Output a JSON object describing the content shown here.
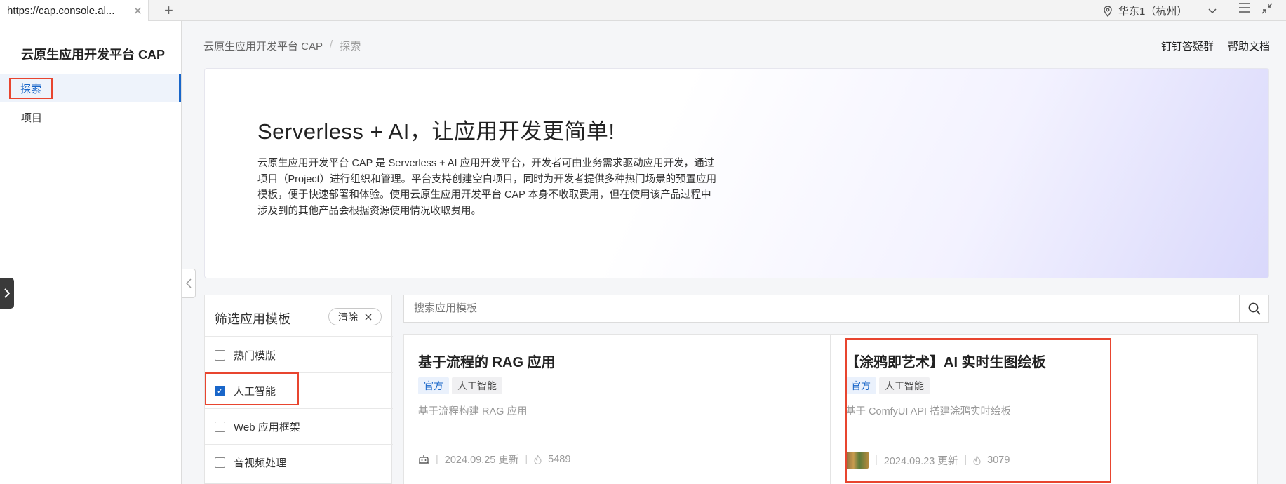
{
  "browser": {
    "tab_title": "https://cap.console.al...",
    "tab_close": "✕",
    "new_tab": "+",
    "region_label": "华东1（杭州）"
  },
  "sidebar": {
    "brand": "云原生应用开发平台 CAP",
    "items": [
      {
        "label": "探索",
        "active": true
      },
      {
        "label": "项目",
        "active": false
      }
    ]
  },
  "header": {
    "breadcrumb": [
      "云原生应用开发平台 CAP",
      "探索"
    ],
    "breadcrumb_sep": "/",
    "links": [
      "钉钉答疑群",
      "帮助文档"
    ]
  },
  "hero": {
    "title": "Serverless + AI，让应用开发更简单!",
    "description": "云原生应用开发平台 CAP 是 Serverless + AI 应用开发平台，开发者可由业务需求驱动应用开发，通过项目（Project）进行组织和管理。平台支持创建空白项目，同时为开发者提供多种热门场景的预置应用模板，便于快速部署和体验。使用云原生应用开发平台 CAP 本身不收取费用，但在使用该产品过程中涉及到的其他产品会根据资源使用情况收取费用。"
  },
  "filter": {
    "title": "筛选应用模板",
    "clear_label": "清除",
    "options": [
      {
        "label": "热门模版",
        "checked": false
      },
      {
        "label": "人工智能",
        "checked": true
      },
      {
        "label": "Web 应用框架",
        "checked": false
      },
      {
        "label": "音视频处理",
        "checked": false
      }
    ]
  },
  "search": {
    "placeholder": "搜索应用模板"
  },
  "cards": [
    {
      "title": "基于流程的 RAG 应用",
      "tags": [
        "官方",
        "人工智能"
      ],
      "description": "基于流程构建 RAG 应用",
      "updated": "2024.09.25 更新",
      "hotness": "5489"
    },
    {
      "title": "【涂鸦即艺术】AI 实时生图绘板",
      "tags": [
        "官方",
        "人工智能"
      ],
      "description": "基于 ComfyUI API 搭建涂鸦实时绘板",
      "updated": "2024.09.23 更新",
      "hotness": "3079"
    }
  ],
  "meta_sep": "|",
  "colors": {
    "accent": "#1966c9",
    "highlight": "#e8452f"
  }
}
